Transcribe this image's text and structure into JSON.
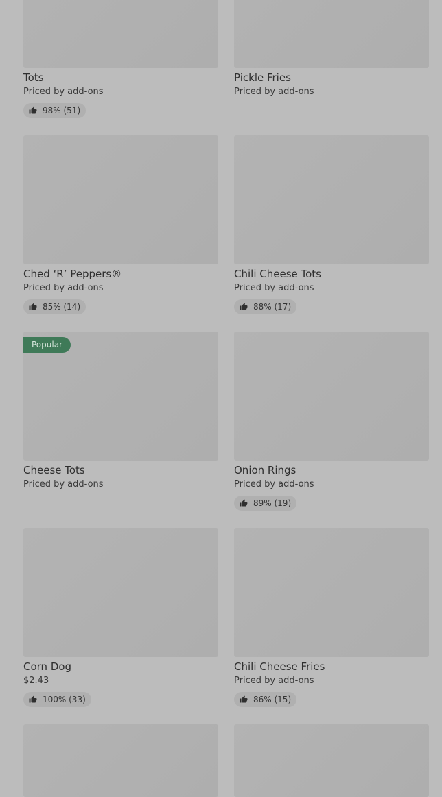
{
  "colors": {
    "background": "#bcbcbc",
    "image_placeholder": "#b1b1b1",
    "popular_badge": "#3f7a58",
    "rating_chip": "#b0b0b0"
  },
  "items": [
    {
      "name": "Tots",
      "price": "Priced by add-ons",
      "rating": "98% (51)",
      "badge": null
    },
    {
      "name": "Pickle Fries",
      "price": "Priced by add-ons",
      "rating": null,
      "badge": null
    },
    {
      "name": "Ched ‘R’ Peppers®",
      "price": "Priced by add-ons",
      "rating": "85% (14)",
      "badge": null
    },
    {
      "name": "Chili Cheese Tots",
      "price": "Priced by add-ons",
      "rating": "88% (17)",
      "badge": null
    },
    {
      "name": "Cheese Tots",
      "price": "Priced by add-ons",
      "rating": null,
      "badge": "Popular"
    },
    {
      "name": "Onion Rings",
      "price": "Priced by add-ons",
      "rating": "89% (19)",
      "badge": null
    },
    {
      "name": "Corn Dog",
      "price": "$2.43",
      "rating": "100% (33)",
      "badge": null
    },
    {
      "name": "Chili Cheese Fries",
      "price": "Priced by add-ons",
      "rating": "86% (15)",
      "badge": null
    },
    {
      "name": "",
      "price": "",
      "rating": null,
      "badge": null
    },
    {
      "name": "",
      "price": "",
      "rating": null,
      "badge": null
    }
  ]
}
